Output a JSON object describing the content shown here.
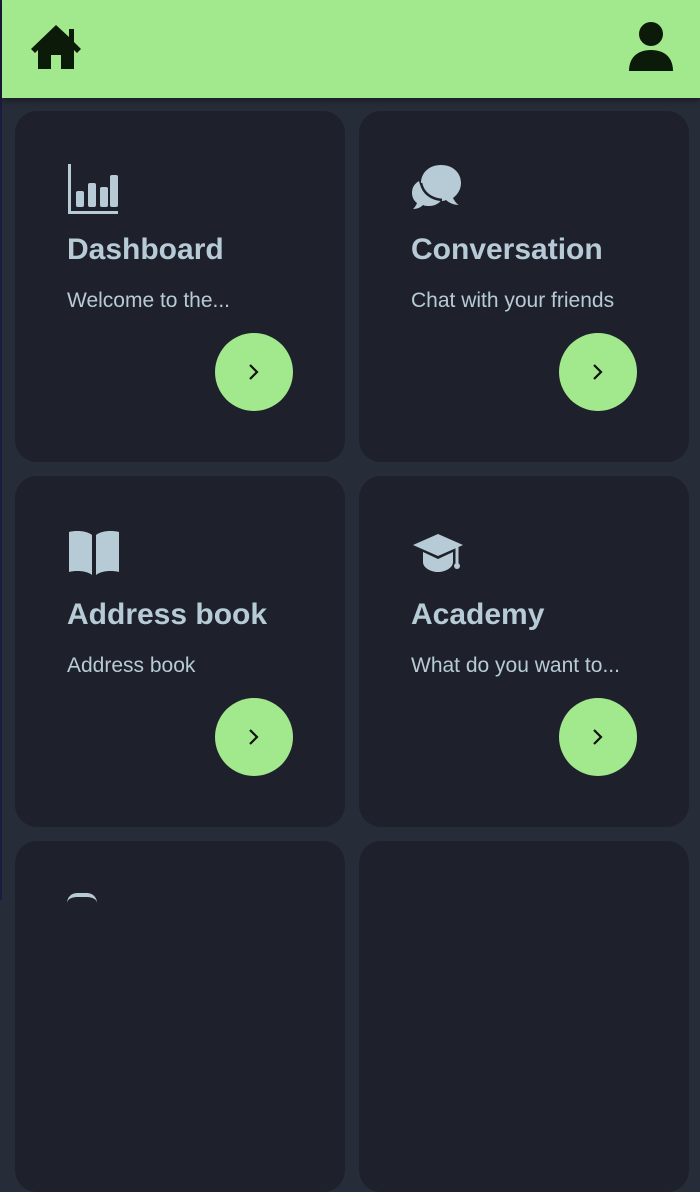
{
  "header": {
    "home_icon": "home-icon",
    "user_icon": "user-icon",
    "background": "#a2e98d"
  },
  "cards": [
    {
      "icon": "bar-chart-icon",
      "title": "Dashboard",
      "description": "Welcome to the..."
    },
    {
      "icon": "chat-bubbles-icon",
      "title": "Conversation",
      "description": "Chat with your friends"
    },
    {
      "icon": "open-book-icon",
      "title": "Address book",
      "description": "Address book"
    },
    {
      "icon": "graduation-cap-icon",
      "title": "Academy",
      "description": "What do you want to..."
    }
  ],
  "colors": {
    "page_background": "#272c39",
    "card_background": "#1e212c",
    "accent": "#a2e98d",
    "text": "#b7cbd6",
    "icon_dark": "#0c1a0a"
  }
}
